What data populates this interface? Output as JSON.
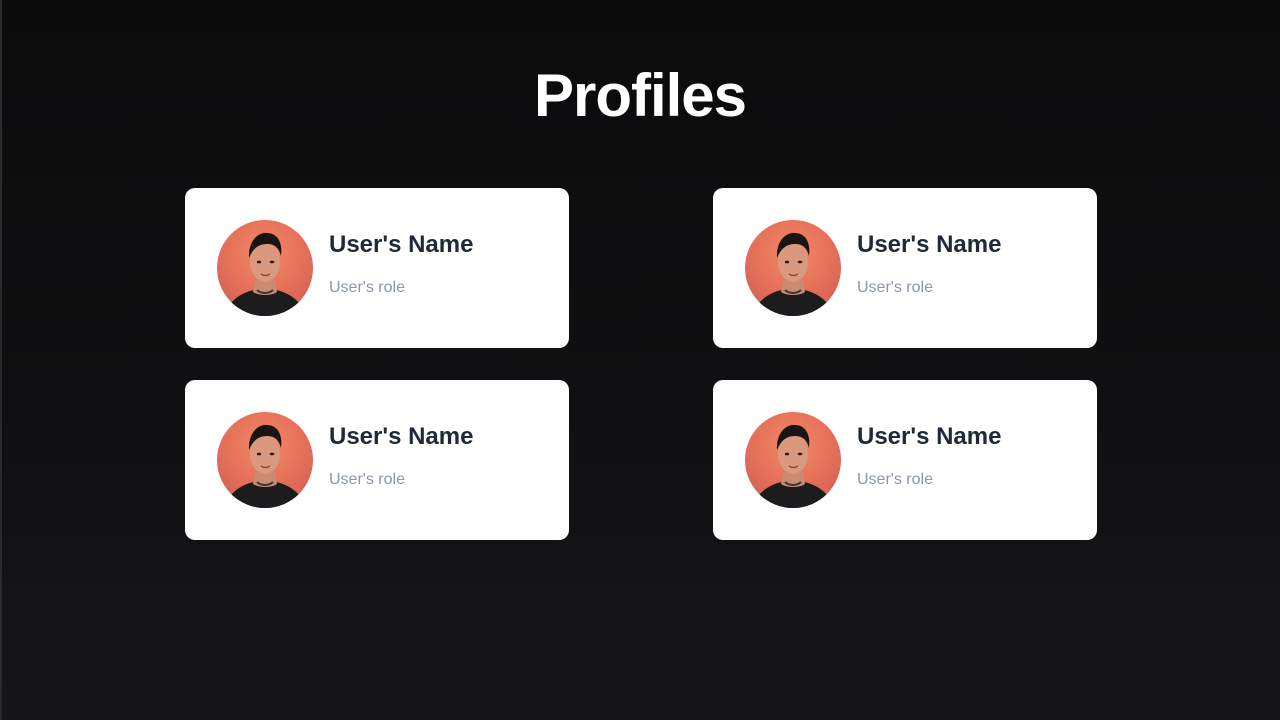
{
  "page": {
    "title": "Profiles"
  },
  "profiles": [
    {
      "name": "User's Name",
      "role": "User's role",
      "avatar_icon": "user-avatar-photo"
    },
    {
      "name": "User's Name",
      "role": "User's role",
      "avatar_icon": "user-avatar-photo"
    },
    {
      "name": "User's Name",
      "role": "User's role",
      "avatar_icon": "user-avatar-photo"
    },
    {
      "name": "User's Name",
      "role": "User's role",
      "avatar_icon": "user-avatar-photo"
    }
  ],
  "colors": {
    "background": "#0b0b0c",
    "card": "#ffffff",
    "name_text": "#1f2937",
    "role_text": "#8a97a8",
    "avatar_background": "#e8725a"
  }
}
